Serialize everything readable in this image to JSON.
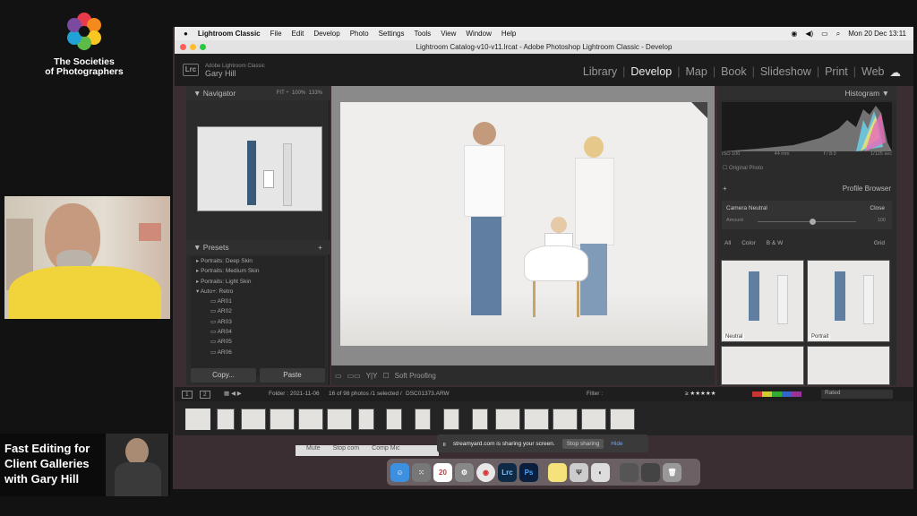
{
  "stream": {
    "org_line1": "The Societies",
    "org_line2": "of Photographers",
    "show_title": "Fast Editing for Client Galleries with Gary Hill",
    "colors": {
      "bg": "#121212"
    }
  },
  "menubar": {
    "app": "Lightroom Classic",
    "items": [
      "File",
      "Edit",
      "Develop",
      "Photo",
      "Settings",
      "Tools",
      "View",
      "Window",
      "Help"
    ],
    "clock": "Mon 20 Dec  13:11"
  },
  "window": {
    "title": "Lightroom Catalog-v10-v11.lrcat - Adobe Photoshop Lightroom Classic - Develop"
  },
  "lr": {
    "badge": "Lrc",
    "brand_small": "Adobe Lightroom Classic",
    "brand_user": "Gary Hill",
    "modules": [
      "Library",
      "Develop",
      "Map",
      "Book",
      "Slideshow",
      "Print",
      "Web"
    ],
    "active_module": "Develop"
  },
  "left": {
    "navigator": "Navigator",
    "nav_zoom": [
      "FIT ÷",
      "100%",
      "133%"
    ],
    "presets_title": "Presets",
    "presets": [
      "Portraits: Deep Skin",
      "Portraits: Medium Skin",
      "Portraits: Light Skin",
      "Auto+: Retro",
      "AR01",
      "AR02",
      "AR03",
      "AR04",
      "AR05",
      "AR06"
    ],
    "copy": "Copy...",
    "paste": "Paste"
  },
  "center": {
    "soft_proofing": "Soft Proofing"
  },
  "right": {
    "histogram": "Histogram",
    "hist_info": [
      "ISO 100",
      "44 mm",
      "f / 8.0",
      "1/125 sec"
    ],
    "original_photo": "Original Photo",
    "profile_browser": "Profile Browser",
    "camera_neutral": "Camera Neutral",
    "close": "Close",
    "amount": "Amount",
    "amount_val": "100",
    "filters": [
      "All",
      "Color",
      "B & W"
    ],
    "grid": "Grid",
    "profiles": [
      "Neutral",
      "Portrait"
    ]
  },
  "filterbar": {
    "folder": "Folder : 2021-11-06",
    "count": "16 of 98 photos /1 selected /",
    "file": "DSC01373.ARW",
    "filter_label": "Filter :",
    "rated": "Rated",
    "pages": [
      "1",
      "2"
    ]
  },
  "share": {
    "msg": "streamyard.com is sharing your screen.",
    "stop": "Stop sharing",
    "hide": "Hide"
  },
  "zoom": {
    "mute": "Mute",
    "stop": "Stop com",
    "comp": "Comp Mic"
  },
  "dock": {
    "calendar_day": "20",
    "apps": [
      "Finder",
      "Launchpad",
      "Calendar",
      "System Preferences",
      "Chrome",
      "Lrc",
      "Ps",
      "Notes",
      "Preview",
      "Trash"
    ]
  }
}
